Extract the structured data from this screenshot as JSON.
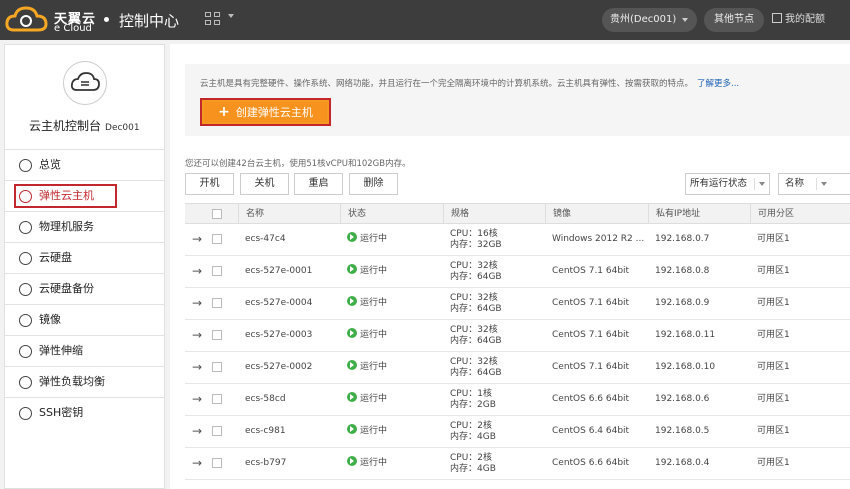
{
  "header": {
    "logo_cn": "天翼云",
    "logo_en": "e Cloud",
    "title": "控制中心",
    "region": "贵州(Dec001)",
    "other_nodes": "其他节点",
    "my_quota": "我的配额"
  },
  "sidebar": {
    "console_title": "云主机控制台",
    "console_sub": "Dec001",
    "items": [
      {
        "label": "总览",
        "icon": "overview-icon"
      },
      {
        "label": "弹性云主机",
        "icon": "ecs-icon"
      },
      {
        "label": "物理机服务",
        "icon": "server-icon"
      },
      {
        "label": "云硬盘",
        "icon": "disk-icon"
      },
      {
        "label": "云硬盘备份",
        "icon": "backup-icon"
      },
      {
        "label": "镜像",
        "icon": "image-icon"
      },
      {
        "label": "弹性伸缩",
        "icon": "scaling-icon"
      },
      {
        "label": "弹性负载均衡",
        "icon": "loadbalance-icon"
      },
      {
        "label": "SSH密钥",
        "icon": "key-icon"
      }
    ]
  },
  "main": {
    "intro": "云主机是具有完整硬件、操作系统、网络功能，并且运行在一个完全隔离环境中的计算机系统。云主机具有弹性、按需获取的特点。",
    "learn_more": "了解更多...",
    "create_label": "创建弹性云主机",
    "quota_note": "您还可以创建42台云主机，使用51核vCPU和102GB内存。",
    "actions": {
      "start": "开机",
      "stop": "关机",
      "restart": "重启",
      "delete": "删除"
    },
    "status_filter": "所有运行状态",
    "name_filter": "名称"
  },
  "table": {
    "headers": {
      "name": "名称",
      "status": "状态",
      "spec": "规格",
      "image": "镜像",
      "ip": "私有IP地址",
      "zone": "可用分区"
    },
    "rows": [
      {
        "name": "ecs-47c4",
        "status": "运行中",
        "cpu": "CPU：16核",
        "mem": "内存：32GB",
        "image": "Windows 2012 R2 ...",
        "ip": "192.168.0.7",
        "zone": "可用区1"
      },
      {
        "name": "ecs-527e-0001",
        "status": "运行中",
        "cpu": "CPU：32核",
        "mem": "内存：64GB",
        "image": "CentOS 7.1 64bit",
        "ip": "192.168.0.8",
        "zone": "可用区1"
      },
      {
        "name": "ecs-527e-0004",
        "status": "运行中",
        "cpu": "CPU：32核",
        "mem": "内存：64GB",
        "image": "CentOS 7.1 64bit",
        "ip": "192.168.0.9",
        "zone": "可用区1"
      },
      {
        "name": "ecs-527e-0003",
        "status": "运行中",
        "cpu": "CPU：32核",
        "mem": "内存：64GB",
        "image": "CentOS 7.1 64bit",
        "ip": "192.168.0.11",
        "zone": "可用区1"
      },
      {
        "name": "ecs-527e-0002",
        "status": "运行中",
        "cpu": "CPU：32核",
        "mem": "内存：64GB",
        "image": "CentOS 7.1 64bit",
        "ip": "192.168.0.10",
        "zone": "可用区1"
      },
      {
        "name": "ecs-58cd",
        "status": "运行中",
        "cpu": "CPU：1核",
        "mem": "内存：2GB",
        "image": "CentOS 6.6 64bit",
        "ip": "192.168.0.6",
        "zone": "可用区1"
      },
      {
        "name": "ecs-c981",
        "status": "运行中",
        "cpu": "CPU：2核",
        "mem": "内存：4GB",
        "image": "CentOS 6.4 64bit",
        "ip": "192.168.0.5",
        "zone": "可用区1"
      },
      {
        "name": "ecs-b797",
        "status": "运行中",
        "cpu": "CPU：2核",
        "mem": "内存：4GB",
        "image": "CentOS 6.6 64bit",
        "ip": "192.168.0.4",
        "zone": "可用区1"
      }
    ]
  }
}
